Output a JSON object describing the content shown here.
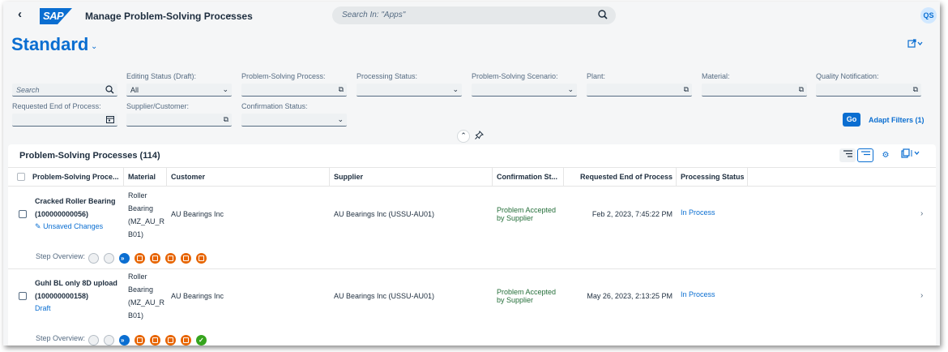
{
  "shell": {
    "back_icon": "back-icon",
    "logo_text": "SAP",
    "app_title": "Manage Problem-Solving Processes",
    "search_placeholder": "Search In: \"Apps\"",
    "avatar_initials": "QS"
  },
  "header": {
    "variant": "Standard"
  },
  "filters": {
    "search_placeholder": "Search",
    "editing_status_label": "Editing Status (Draft):",
    "editing_status_value": "All",
    "process_label": "Problem-Solving Process:",
    "processing_status_label": "Processing Status:",
    "scenario_label": "Problem-Solving Scenario:",
    "plant_label": "Plant:",
    "material_label": "Material:",
    "quality_notification_label": "Quality Notification:",
    "requested_end_label": "Requested End of Process:",
    "supplier_customer_label": "Supplier/Customer:",
    "confirmation_status_label": "Confirmation Status:",
    "go_label": "Go",
    "adapt_label": "Adapt Filters (1)"
  },
  "table": {
    "title": "Problem-Solving Processes (114)",
    "columns": [
      "Problem-Solving Proce...",
      "Material",
      "Customer",
      "Supplier",
      "Confirmation St...",
      "Requested End of Process",
      "Processing Status"
    ],
    "step_overview_label": "Step Overview:",
    "rows": [
      {
        "title": "Cracked Roller Bearing",
        "id": "(100000000056)",
        "draft_status": "Unsaved Changes",
        "material": [
          "Roller",
          "Bearing",
          "(MZ_AU_R",
          "B01)"
        ],
        "customer": "AU Bearings Inc",
        "supplier": "AU Bearings Inc (USSU-AU01)",
        "confirmation": [
          "Problem Accepted",
          "by Supplier"
        ],
        "requested_end": "Feb 2, 2023, 7:45:22 PM",
        "processing_status": "In Process",
        "steps": [
          "grey",
          "grey",
          "blue",
          "orange",
          "orange",
          "orange",
          "orange",
          "orange"
        ]
      },
      {
        "title": "Guhl BL only 8D upload",
        "id": "(100000000158)",
        "draft_status": "Draft",
        "material": [
          "Roller",
          "Bearing",
          "(MZ_AU_R",
          "B01)"
        ],
        "customer": "AU Bearings Inc",
        "supplier": "AU Bearings Inc (USSU-AU01)",
        "confirmation": [
          "Problem Accepted",
          "by Supplier"
        ],
        "requested_end": "May 26, 2023, 2:13:25 PM",
        "processing_status": "In Process",
        "steps": [
          "grey",
          "grey",
          "blue",
          "orange",
          "orange",
          "orange",
          "orange",
          "green"
        ]
      }
    ]
  },
  "colors": {
    "accent": "#0a6ed1",
    "step_orange": "#e76500",
    "step_green": "#36a41d",
    "positive_text": "#256f3a"
  }
}
